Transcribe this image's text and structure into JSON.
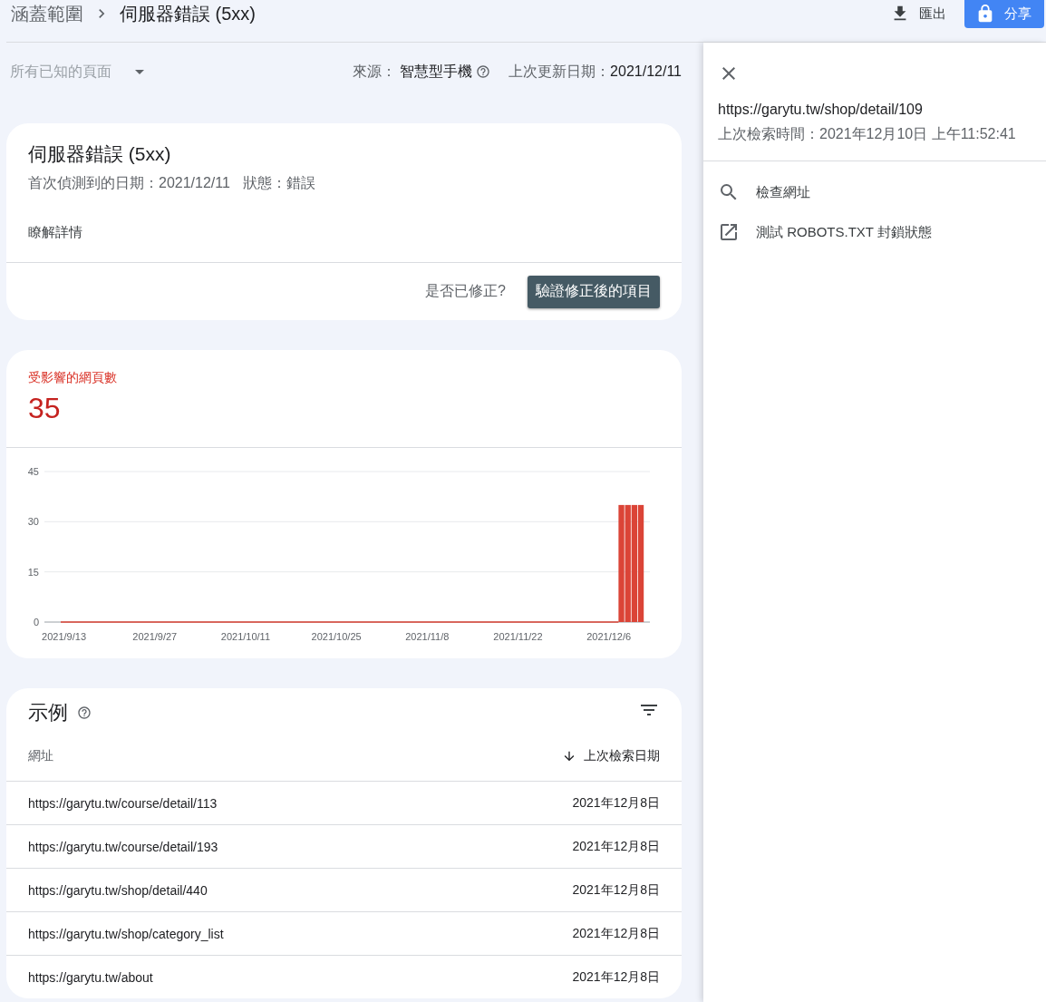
{
  "breadcrumb": {
    "parent": "涵蓋範圍",
    "current": "伺服器錯誤 (5xx)"
  },
  "header_actions": {
    "export": "匯出",
    "share": "分享"
  },
  "filter": {
    "page_filter": "所有已知的頁面",
    "source_label": "來源：",
    "source_value": "智慧型手機",
    "updated_label": "上次更新日期：",
    "updated_value": "2021/12/11"
  },
  "issue_card": {
    "title": "伺服器錯誤 (5xx)",
    "first_detected": "首次偵測到的日期：2021/12/11",
    "status": "狀態：錯誤",
    "learn_more": "瞭解詳情",
    "fixed_question": "是否已修正?",
    "validate_button": "驗證修正後的項目"
  },
  "affected": {
    "label": "受影響的網頁數",
    "count": "35",
    "chart_data": {
      "type": "bar",
      "categories": [
        "2021/9/13",
        null,
        null,
        null,
        null,
        null,
        null,
        null,
        null,
        null,
        null,
        null,
        null,
        null,
        "2021/9/27",
        null,
        null,
        null,
        null,
        null,
        null,
        null,
        null,
        null,
        null,
        null,
        null,
        null,
        "2021/10/11",
        null,
        null,
        null,
        null,
        null,
        null,
        null,
        null,
        null,
        null,
        null,
        null,
        null,
        "2021/10/25",
        null,
        null,
        null,
        null,
        null,
        null,
        null,
        null,
        null,
        null,
        null,
        null,
        null,
        "2021/11/8",
        null,
        null,
        null,
        null,
        null,
        null,
        null,
        null,
        null,
        null,
        null,
        null,
        null,
        "2021/11/22",
        null,
        null,
        null,
        null,
        null,
        null,
        null,
        null,
        null,
        null,
        null,
        null,
        null,
        "2021/12/6",
        null,
        null,
        null,
        null,
        null
      ],
      "series": [
        {
          "color": "#db4437",
          "values": [
            0,
            0,
            0,
            0,
            0,
            0,
            0,
            0,
            0,
            0,
            0,
            0,
            0,
            0,
            0,
            0,
            0,
            0,
            0,
            0,
            0,
            0,
            0,
            0,
            0,
            0,
            0,
            0,
            0,
            0,
            0,
            0,
            0,
            0,
            0,
            0,
            0,
            0,
            0,
            0,
            0,
            0,
            0,
            0,
            0,
            0,
            0,
            0,
            0,
            0,
            0,
            0,
            0,
            0,
            0,
            0,
            0,
            0,
            0,
            0,
            0,
            0,
            0,
            0,
            0,
            0,
            0,
            0,
            0,
            0,
            0,
            0,
            0,
            0,
            0,
            0,
            0,
            0,
            0,
            0,
            0,
            0,
            0,
            0,
            0,
            0,
            35,
            35,
            35,
            35
          ]
        }
      ],
      "ylim": [
        0,
        45
      ],
      "yticks": [
        0,
        15,
        30,
        45
      ]
    }
  },
  "examples": {
    "title": "示例",
    "columns": [
      "網址",
      "上次檢索日期"
    ],
    "rows": [
      {
        "url": "https://garytu.tw/course/detail/113",
        "date": "2021年12月8日"
      },
      {
        "url": "https://garytu.tw/course/detail/193",
        "date": "2021年12月8日"
      },
      {
        "url": "https://garytu.tw/shop/detail/440",
        "date": "2021年12月8日"
      },
      {
        "url": "https://garytu.tw/shop/category_list",
        "date": "2021年12月8日"
      },
      {
        "url": "https://garytu.tw/about",
        "date": "2021年12月8日"
      }
    ]
  },
  "detail_panel": {
    "url": "https://garytu.tw/shop/detail/109",
    "crawl_time": "上次檢索時間：2021年12月10日 上午11:52:41",
    "actions": [
      {
        "kind": "inspect",
        "label": "檢查網址"
      },
      {
        "kind": "external",
        "label": "測試 ROBOTS.TXT 封鎖狀態"
      }
    ]
  }
}
